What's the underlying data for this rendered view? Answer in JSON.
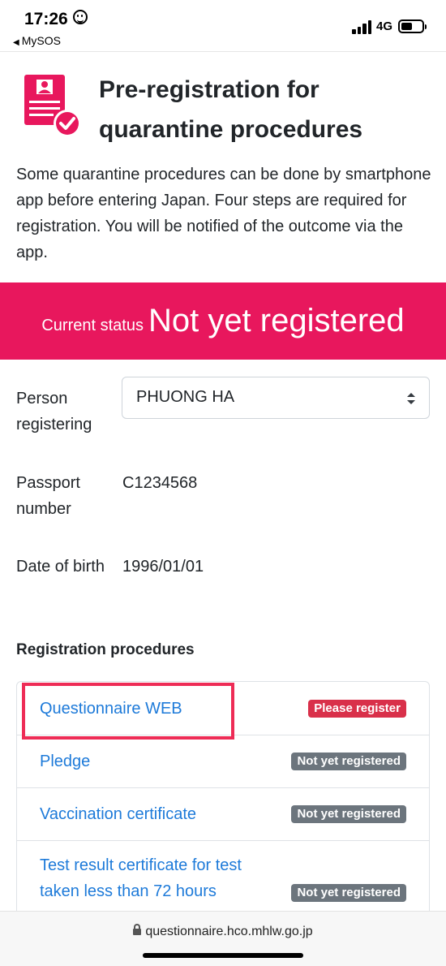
{
  "status_bar": {
    "time": "17:26",
    "back_label": "MySOS",
    "network": "4G",
    "battery_level": 0.55
  },
  "header": {
    "title": "Pre-registration for quarantine procedures",
    "icon": "document-checkmark-icon",
    "intro": "Some quarantine procedures can be done by smartphone app before entering Japan. Four steps are required for registration. You will be notified of the outcome via the app."
  },
  "status_banner": {
    "label": "Current status",
    "value": "Not yet registered",
    "color": "#e8175d"
  },
  "fields": {
    "person_label": "Person registering",
    "person_value": "PHUONG HA",
    "passport_label": "Passport number",
    "passport_value": "C1234568",
    "dob_label": "Date of birth",
    "dob_value": "1996/01/01"
  },
  "procedures": {
    "heading": "Registration procedures",
    "items": [
      {
        "label": "Questionnaire WEB",
        "status": "Please register",
        "status_color": "#d9304a"
      },
      {
        "label": "Pledge",
        "status": "Not yet registered",
        "status_color": "#6c757d"
      },
      {
        "label": "Vaccination certificate",
        "status": "Not yet registered",
        "status_color": "#6c757d"
      },
      {
        "label": "Test result certificate for test taken less than 72 hours",
        "status": "Not yet registered",
        "status_color": "#6c757d"
      }
    ]
  },
  "url_bar": {
    "url": "questionnaire.hco.mhlw.go.jp"
  }
}
